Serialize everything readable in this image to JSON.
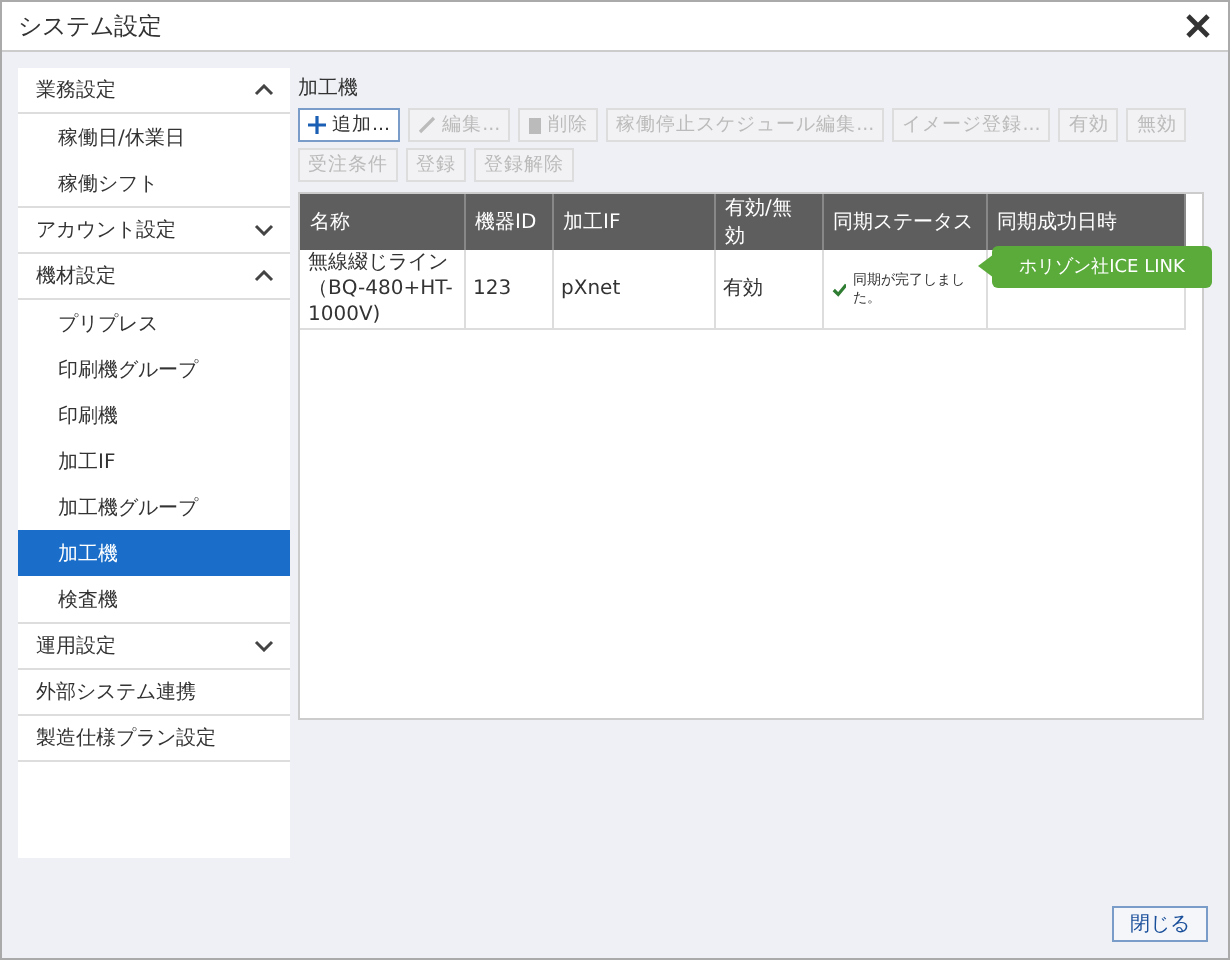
{
  "window": {
    "title": "システム設定"
  },
  "sidebar": {
    "sections": [
      {
        "label": "業務設定",
        "expanded": true,
        "children": [
          {
            "label": "稼働日/休業日",
            "selected": false
          },
          {
            "label": "稼働シフト",
            "selected": false
          }
        ]
      },
      {
        "label": "アカウント設定",
        "expanded": false
      },
      {
        "label": "機材設定",
        "expanded": true,
        "children": [
          {
            "label": "プリプレス",
            "selected": false
          },
          {
            "label": "印刷機グループ",
            "selected": false
          },
          {
            "label": "印刷機",
            "selected": false
          },
          {
            "label": "加工IF",
            "selected": false
          },
          {
            "label": "加工機グループ",
            "selected": false
          },
          {
            "label": "加工機",
            "selected": true
          },
          {
            "label": "検査機",
            "selected": false
          }
        ]
      },
      {
        "label": "運用設定",
        "expanded": false
      },
      {
        "label": "外部システム連携"
      },
      {
        "label": "製造仕様プラン設定"
      }
    ]
  },
  "content": {
    "heading": "加工機",
    "toolbar": [
      {
        "label": "追加...",
        "kind": "add",
        "disabled": false
      },
      {
        "label": "編集...",
        "kind": "edit",
        "disabled": true
      },
      {
        "label": "削除",
        "kind": "delete",
        "disabled": true
      },
      {
        "label": "稼働停止スケジュール編集...",
        "kind": "text",
        "disabled": true
      },
      {
        "label": "イメージ登録...",
        "kind": "text",
        "disabled": true
      },
      {
        "label": "有効",
        "kind": "text",
        "disabled": true
      },
      {
        "label": "無効",
        "kind": "text",
        "disabled": true
      },
      {
        "label": "受注条件",
        "kind": "text",
        "disabled": true
      },
      {
        "label": "登録",
        "kind": "text",
        "disabled": true
      },
      {
        "label": "登録解除",
        "kind": "text",
        "disabled": true
      }
    ],
    "table": {
      "columns": [
        "名称",
        "機器ID",
        "加工IF",
        "有効/無効",
        "同期ステータス",
        "同期成功日時"
      ],
      "rows": [
        {
          "name": "無線綴じライン（BQ-480+HT-1000V)",
          "id": "123",
          "interface": "pXnet",
          "enabled": "有効",
          "sync_ok": true,
          "status": "同期が完了しました。",
          "selected": false
        }
      ]
    },
    "tooltip": "ホリゾン社ICE LINK"
  },
  "buttons": [
    "閉じる"
  ]
}
